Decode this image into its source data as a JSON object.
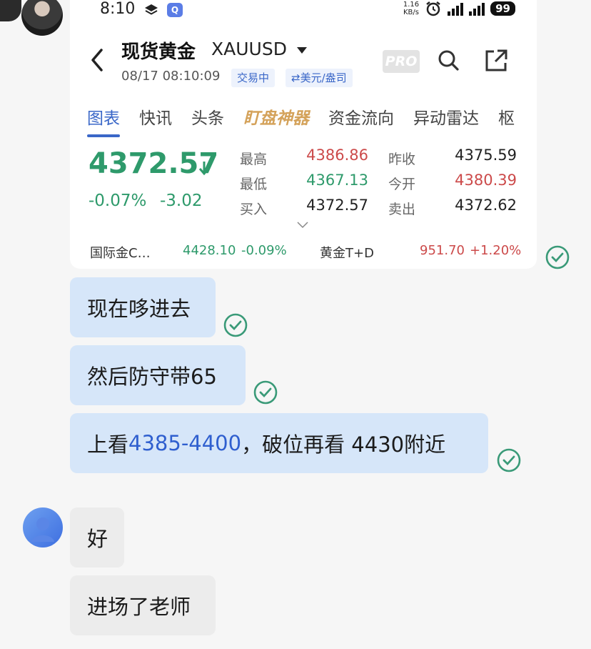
{
  "status_bar": {
    "time": "8:10",
    "netspeed_value": "1.16",
    "netspeed_unit": "KB/s",
    "battery": "99"
  },
  "card": {
    "title": "现货黄金",
    "symbol": "XAUUSD",
    "datetime": "08/17 08:10:09",
    "trading_status": "交易中",
    "currency": "⇄美元/盎司",
    "pro_label": "PRO",
    "tabs": [
      "图表",
      "快讯",
      "头条",
      "盯盘神器",
      "资金流向",
      "异动雷达",
      "枢"
    ],
    "price": "4372.57",
    "change_pct": "-0.07%",
    "change_val": "-3.02",
    "stats": {
      "high_label": "最高",
      "high": "4386.86",
      "low_label": "最低",
      "low": "4367.13",
      "buy_label": "买入",
      "buy": "4372.57",
      "prev_close_label": "昨收",
      "prev_close": "4375.59",
      "open_label": "今开",
      "open": "4380.39",
      "sell_label": "卖出",
      "sell": "4372.62"
    },
    "ticker": {
      "left_name": "国际金C…",
      "left_price": "4428.10",
      "left_change": "-0.09%",
      "right_name": "黄金T+D",
      "right_price": "951.70",
      "right_change": "+1.20%"
    }
  },
  "messages": {
    "m1": "现在哆进去",
    "m2": "然后防守带65",
    "m3_prefix": "上看",
    "m3_highlight": "4385-4400",
    "m3_suffix": "，破位再看 4430附近",
    "r1": "好",
    "r2": "进场了老师"
  },
  "colors": {
    "up": "#cc4a4a",
    "down": "#2e9a6b",
    "accent": "#3a67c8",
    "check": "#3a9a78",
    "sent_bubble": "#d6e6f9",
    "received_bubble": "#ececec"
  }
}
